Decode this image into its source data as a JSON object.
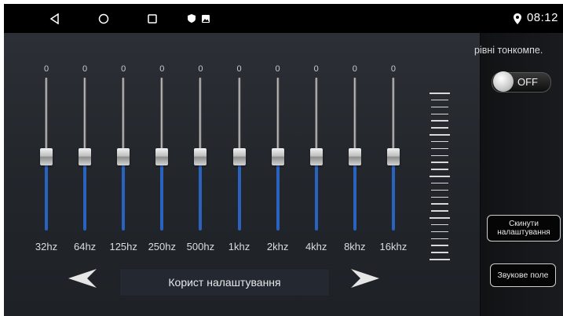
{
  "status_bar": {
    "nav_buttons": [
      "back",
      "home",
      "recents"
    ],
    "time": "08:12",
    "icons": [
      "shield-icon",
      "gallery-icon",
      "location-icon"
    ]
  },
  "equalizer": {
    "bands": [
      {
        "label": "32hz",
        "value": "0"
      },
      {
        "label": "64hz",
        "value": "0"
      },
      {
        "label": "125hz",
        "value": "0"
      },
      {
        "label": "250hz",
        "value": "0"
      },
      {
        "label": "500hz",
        "value": "0"
      },
      {
        "label": "1khz",
        "value": "0"
      },
      {
        "label": "2khz",
        "value": "0"
      },
      {
        "label": "4khz",
        "value": "0"
      },
      {
        "label": "8khz",
        "value": "0"
      },
      {
        "label": "16khz",
        "value": "0"
      }
    ],
    "preset_name": "Корист налаштування"
  },
  "side_panel": {
    "title": "рівні тонкомпе.",
    "toggle_label": "OFF",
    "reset_button": "Скинути налаштування",
    "sound_field_button": "Звукове поле"
  },
  "colors": {
    "accent": "#2a62c0",
    "background": "#22262b"
  }
}
